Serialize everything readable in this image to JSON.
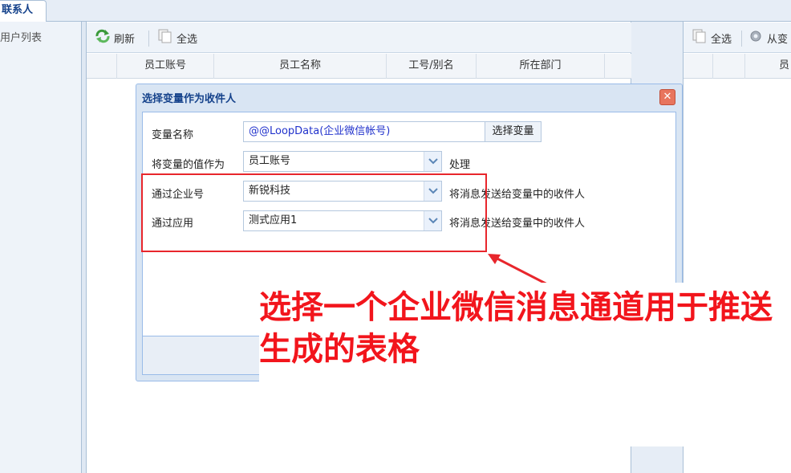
{
  "tabs": {
    "active_label": "联系人"
  },
  "left_panel": {
    "title": "用户列表"
  },
  "center_toolbar": {
    "refresh_label": "刷新",
    "select_all_label": "全选"
  },
  "grid": {
    "columns": [
      "员工账号",
      "员工名称",
      "工号/别名",
      "所在部门"
    ]
  },
  "right_toolbar": {
    "select_all_label": "全选",
    "from_var_label": "从变"
  },
  "right_grid": {
    "column_partial": "员"
  },
  "dialog": {
    "title": "选择变量作为收件人",
    "close_glyph": "✕",
    "var_name_label": "变量名称",
    "var_name_value": "@@LoopData(企业微信帐号)",
    "select_var_button": "选择变量",
    "value_as_label": "将变量的值作为",
    "value_as_selected": "员工账号",
    "value_as_suffix": "处理",
    "corp_label": "通过企业号",
    "corp_selected": "新锐科技",
    "corp_suffix": "将消息发送给变量中的收件人",
    "app_label": "通过应用",
    "app_selected": "测式应用1",
    "app_suffix": "将消息发送给变量中的收件人"
  },
  "annotation": {
    "text": "选择一个企业微信消息通道用于推送生成的表格"
  },
  "colors": {
    "highlight_red": "#e8262c",
    "annotation_red": "#f2151c",
    "header_blue": "#15428b"
  },
  "icons": {
    "refresh": "refresh-icon",
    "select_all": "select-all-icon",
    "gear": "gear-icon",
    "combo": "chevron-down-icon",
    "close": "close-icon"
  }
}
